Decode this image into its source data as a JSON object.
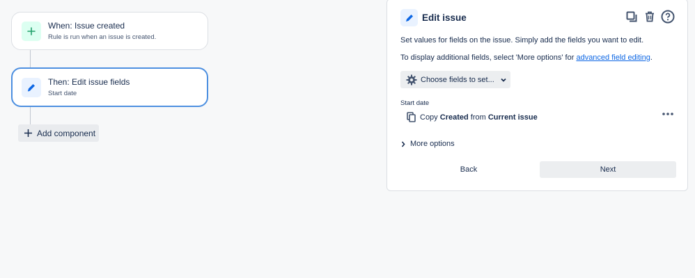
{
  "rule": {
    "trigger": {
      "title": "When: Issue created",
      "subtitle": "Rule is run when an issue is created.",
      "icon": "plus-icon"
    },
    "action": {
      "title": "Then: Edit issue fields",
      "subtitle": "Start date",
      "icon": "pencil-icon"
    },
    "add_component_label": "Add component"
  },
  "panel": {
    "title": "Edit issue",
    "icon": "pencil-icon",
    "header_actions": [
      "duplicate-icon",
      "trash-icon",
      "help-icon"
    ],
    "description_1": "Set values for fields on the issue. Simply add the fields you want to edit.",
    "description_2_prefix": "To display additional fields, select 'More options' for ",
    "description_2_link": "advanced field editing",
    "description_2_suffix": ".",
    "choose_fields_label": "Choose fields to set...",
    "field": {
      "label": "Start date",
      "copy_word": "Copy",
      "source_field": "Created",
      "from_word": "from",
      "source_issue": "Current issue"
    },
    "more_options_label": "More options",
    "back_label": "Back",
    "next_label": "Next"
  },
  "colors": {
    "accent": "#0c66e4",
    "selected_border": "#4c8fe0",
    "trigger_icon": "#22a06b"
  }
}
